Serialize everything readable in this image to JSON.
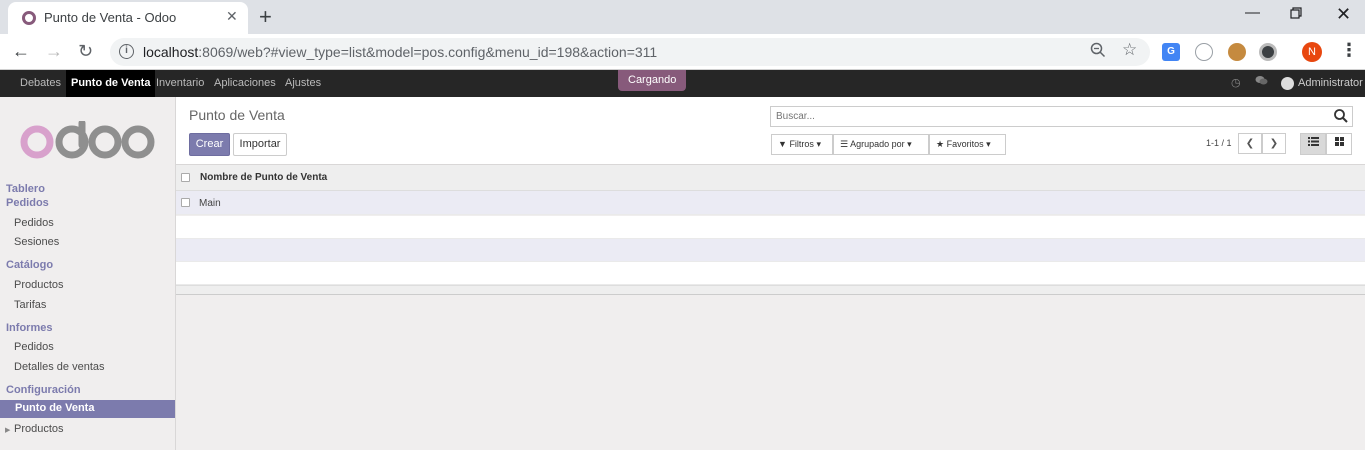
{
  "browser": {
    "tab_title": "Punto de Venta - Odoo",
    "tab_close": "✕",
    "new_tab": "+",
    "url_host": "localhost",
    "url_rest": ":8069/web?#view_type=list&model=pos.config&menu_id=198&action=311",
    "profile_initial": "N",
    "translate_ext": "G"
  },
  "odoo_nav": {
    "menus": [
      "Debates",
      "Punto de Venta",
      "Inventario",
      "Aplicaciones",
      "Ajustes"
    ],
    "active_menu": "Punto de Venta",
    "loading": "Cargando",
    "user": "Administrator"
  },
  "sidebar": {
    "logo_text": "odoo",
    "sections": [
      {
        "title": "Tablero",
        "items": []
      },
      {
        "title": "Pedidos",
        "items": [
          "Pedidos",
          "Sesiones"
        ]
      },
      {
        "title": "Catálogo",
        "items": [
          "Productos",
          "Tarifas"
        ]
      },
      {
        "title": "Informes",
        "items": [
          "Pedidos",
          "Detalles de ventas"
        ]
      },
      {
        "title": "Configuración",
        "items": [
          "Punto de Venta",
          "Productos"
        ]
      }
    ],
    "active_item": "Punto de Venta"
  },
  "control_panel": {
    "breadcrumb": "Punto de Venta",
    "create_label": "Crear",
    "import_label": "Importar",
    "search_placeholder": "Buscar...",
    "filters_label": "Filtros",
    "groupby_label": "Agrupado por",
    "favorites_label": "Favoritos",
    "pager": "1-1 / 1"
  },
  "list": {
    "columns": [
      "Nombre de Punto de Venta"
    ],
    "rows": [
      [
        "Main"
      ]
    ]
  },
  "colors": {
    "odoo_primary": "#7c7bad",
    "odoo_brand": "#875a7b",
    "navbar_bg": "#262626"
  }
}
